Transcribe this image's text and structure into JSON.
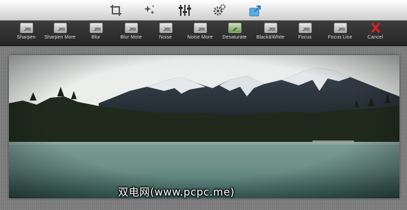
{
  "top_tools": [
    {
      "icon": "crop-icon"
    },
    {
      "icon": "sparkle-effects-icon"
    },
    {
      "icon": "adjust-sliders-icon"
    },
    {
      "icon": "gears-icon"
    },
    {
      "icon": "save-share-icon"
    }
  ],
  "effects_toolbar": {
    "buttons": [
      {
        "label": "Sharpen",
        "icon": "sharpen-icon"
      },
      {
        "label": "Sharpen More",
        "icon": "sharpen-more-icon"
      },
      {
        "label": "Blur",
        "icon": "blur-icon"
      },
      {
        "label": "Blur More",
        "icon": "blur-more-icon"
      },
      {
        "label": "Noise",
        "icon": "noise-icon"
      },
      {
        "label": "Noise More",
        "icon": "noise-more-icon"
      },
      {
        "label": "Desaturate",
        "icon": "desaturate-icon"
      },
      {
        "label": "Black&White",
        "icon": "black-white-icon"
      },
      {
        "label": "Focus",
        "icon": "focus-icon"
      },
      {
        "label": "Focus Line",
        "icon": "focus-line-icon"
      },
      {
        "label": "Cancel",
        "icon": "cancel-icon"
      }
    ]
  },
  "canvas": {
    "image_alt": "mountain lake landscape photo"
  },
  "watermark": {
    "text": "双电网(www.pcpc.me)"
  },
  "colors": {
    "toolbar_bg": "#2e2e2e",
    "cancel_red": "#d9231d",
    "active_icon_blue": "#3a9ad9"
  }
}
